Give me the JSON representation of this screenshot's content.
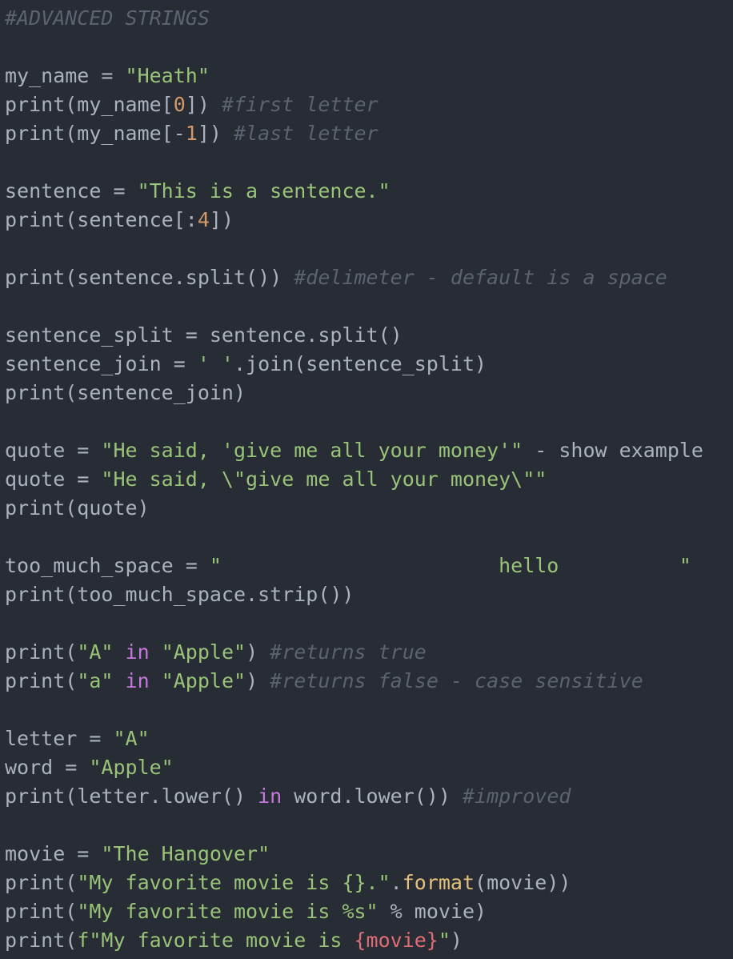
{
  "theme": {
    "background": "#282c34",
    "colors": {
      "plain": "#abb2bf",
      "string": "#98c379",
      "number": "#d19a66",
      "comment": "#5c6370",
      "keyword": "#c678dd",
      "builtin": "#e5c07b",
      "interp": "#e06c75"
    }
  },
  "lines": [
    [
      {
        "t": "comment",
        "v": "#ADVANCED STRINGS"
      }
    ],
    [],
    [
      {
        "t": "plain",
        "v": "my_name = "
      },
      {
        "t": "string",
        "v": "\"Heath\""
      }
    ],
    [
      {
        "t": "plain",
        "v": "print(my_name["
      },
      {
        "t": "number",
        "v": "0"
      },
      {
        "t": "plain",
        "v": "]) "
      },
      {
        "t": "comment",
        "v": "#first letter"
      }
    ],
    [
      {
        "t": "plain",
        "v": "print(my_name[-"
      },
      {
        "t": "number",
        "v": "1"
      },
      {
        "t": "plain",
        "v": "]) "
      },
      {
        "t": "comment",
        "v": "#last letter"
      }
    ],
    [],
    [
      {
        "t": "plain",
        "v": "sentence = "
      },
      {
        "t": "string",
        "v": "\"This is a sentence.\""
      }
    ],
    [
      {
        "t": "plain",
        "v": "print(sentence[:"
      },
      {
        "t": "number",
        "v": "4"
      },
      {
        "t": "plain",
        "v": "])"
      }
    ],
    [],
    [
      {
        "t": "plain",
        "v": "print(sentence.split()) "
      },
      {
        "t": "comment",
        "v": "#delimeter - default is a space"
      }
    ],
    [],
    [
      {
        "t": "plain",
        "v": "sentence_split = sentence.split()"
      }
    ],
    [
      {
        "t": "plain",
        "v": "sentence_join = "
      },
      {
        "t": "string",
        "v": "' '"
      },
      {
        "t": "plain",
        "v": ".join(sentence_split)"
      }
    ],
    [
      {
        "t": "plain",
        "v": "print(sentence_join)"
      }
    ],
    [],
    [
      {
        "t": "plain",
        "v": "quote = "
      },
      {
        "t": "string",
        "v": "\"He said, 'give me all your money'\""
      },
      {
        "t": "plain",
        "v": " - show example"
      }
    ],
    [
      {
        "t": "plain",
        "v": "quote = "
      },
      {
        "t": "string",
        "v": "\"He said, \\\"give me all your money\\\"\""
      }
    ],
    [
      {
        "t": "plain",
        "v": "print(quote)"
      }
    ],
    [],
    [
      {
        "t": "plain",
        "v": "too_much_space = "
      },
      {
        "t": "string",
        "v": "\"                       hello          \""
      }
    ],
    [
      {
        "t": "plain",
        "v": "print(too_much_space.strip())"
      }
    ],
    [],
    [
      {
        "t": "plain",
        "v": "print("
      },
      {
        "t": "string",
        "v": "\"A\""
      },
      {
        "t": "plain",
        "v": " "
      },
      {
        "t": "keyword",
        "v": "in"
      },
      {
        "t": "plain",
        "v": " "
      },
      {
        "t": "string",
        "v": "\"Apple\""
      },
      {
        "t": "plain",
        "v": ") "
      },
      {
        "t": "comment",
        "v": "#returns true"
      }
    ],
    [
      {
        "t": "plain",
        "v": "print("
      },
      {
        "t": "string",
        "v": "\"a\""
      },
      {
        "t": "plain",
        "v": " "
      },
      {
        "t": "keyword",
        "v": "in"
      },
      {
        "t": "plain",
        "v": " "
      },
      {
        "t": "string",
        "v": "\"Apple\""
      },
      {
        "t": "plain",
        "v": ") "
      },
      {
        "t": "comment",
        "v": "#returns false - case sensitive"
      }
    ],
    [],
    [
      {
        "t": "plain",
        "v": "letter = "
      },
      {
        "t": "string",
        "v": "\"A\""
      }
    ],
    [
      {
        "t": "plain",
        "v": "word = "
      },
      {
        "t": "string",
        "v": "\"Apple\""
      }
    ],
    [
      {
        "t": "plain",
        "v": "print(letter.lower() "
      },
      {
        "t": "keyword",
        "v": "in"
      },
      {
        "t": "plain",
        "v": " word.lower()) "
      },
      {
        "t": "comment",
        "v": "#improved"
      }
    ],
    [],
    [
      {
        "t": "plain",
        "v": "movie = "
      },
      {
        "t": "string",
        "v": "\"The Hangover\""
      }
    ],
    [
      {
        "t": "plain",
        "v": "print("
      },
      {
        "t": "string",
        "v": "\"My favorite movie is {}.\""
      },
      {
        "t": "plain",
        "v": "."
      },
      {
        "t": "builtin",
        "v": "format"
      },
      {
        "t": "plain",
        "v": "(movie))"
      }
    ],
    [
      {
        "t": "plain",
        "v": "print("
      },
      {
        "t": "string",
        "v": "\"My favorite movie is %s\""
      },
      {
        "t": "plain",
        "v": " % movie)"
      }
    ],
    [
      {
        "t": "plain",
        "v": "print("
      },
      {
        "t": "string",
        "v": "f\"My favorite movie is "
      },
      {
        "t": "interp",
        "v": "{movie}"
      },
      {
        "t": "string",
        "v": "\""
      },
      {
        "t": "plain",
        "v": ")"
      }
    ]
  ]
}
